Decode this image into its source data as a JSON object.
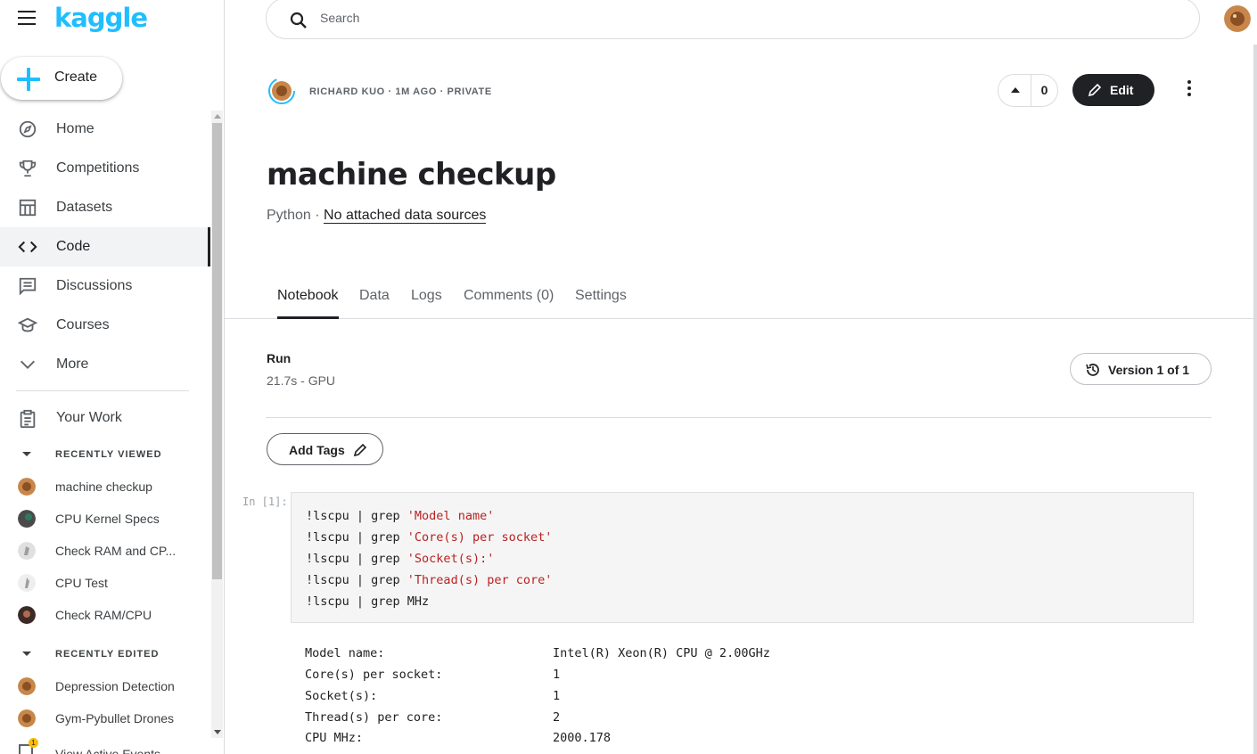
{
  "brand": {
    "logo_text": "kaggle",
    "logo_color": "#20beff"
  },
  "create": {
    "label": "Create"
  },
  "nav": [
    {
      "label": "Home",
      "icon": "compass-icon"
    },
    {
      "label": "Competitions",
      "icon": "trophy-icon"
    },
    {
      "label": "Datasets",
      "icon": "table-icon"
    },
    {
      "label": "Code",
      "icon": "code-icon",
      "active": true
    },
    {
      "label": "Discussions",
      "icon": "comments-icon"
    },
    {
      "label": "Courses",
      "icon": "graduation-cap-icon"
    },
    {
      "label": "More",
      "icon": "chevron-down-icon"
    }
  ],
  "your_work": {
    "label": "Your Work"
  },
  "recently_viewed": {
    "heading": "RECENTLY VIEWED",
    "items": [
      "machine checkup",
      "CPU Kernel Specs",
      "Check RAM and CP...",
      "CPU Test",
      "Check RAM/CPU"
    ]
  },
  "recently_edited": {
    "heading": "RECENTLY EDITED",
    "items": [
      "Depression Detection",
      "Gym-Pybullet Drones"
    ]
  },
  "events": {
    "badge": "1",
    "label": "View Active Events"
  },
  "search": {
    "placeholder": "Search"
  },
  "notebook": {
    "author_meta": "RICHARD KUO · 1M AGO · PRIVATE",
    "votes": "0",
    "edit_label": "Edit",
    "title": "machine checkup",
    "language": "Python",
    "separator": "·",
    "data_sources": "No attached data sources"
  },
  "tabs": [
    "Notebook",
    "Data",
    "Logs",
    "Comments (0)",
    "Settings"
  ],
  "run": {
    "label": "Run",
    "info": "21.7s - GPU",
    "version": "Version 1 of 1"
  },
  "tags": {
    "label": "Add Tags"
  },
  "cell": {
    "prompt": "In [1]:",
    "lines": [
      {
        "cmd": "!lscpu | grep ",
        "str": "'Model name'"
      },
      {
        "cmd": "!lscpu | grep ",
        "str": "'Core(s) per socket'"
      },
      {
        "cmd": "!lscpu | grep ",
        "str": "'Socket(s):'"
      },
      {
        "cmd": "!lscpu | grep ",
        "str": "'Thread(s) per core'"
      },
      {
        "cmd": "!lscpu | grep MHz",
        "str": ""
      }
    ],
    "output": [
      {
        "key": "Model name:",
        "value": "Intel(R) Xeon(R) CPU @ 2.00GHz"
      },
      {
        "key": "Core(s) per socket:",
        "value": "1"
      },
      {
        "key": "Socket(s):",
        "value": "1"
      },
      {
        "key": "Thread(s) per core:",
        "value": "2"
      },
      {
        "key": "CPU MHz:",
        "value": "2000.178"
      }
    ]
  }
}
